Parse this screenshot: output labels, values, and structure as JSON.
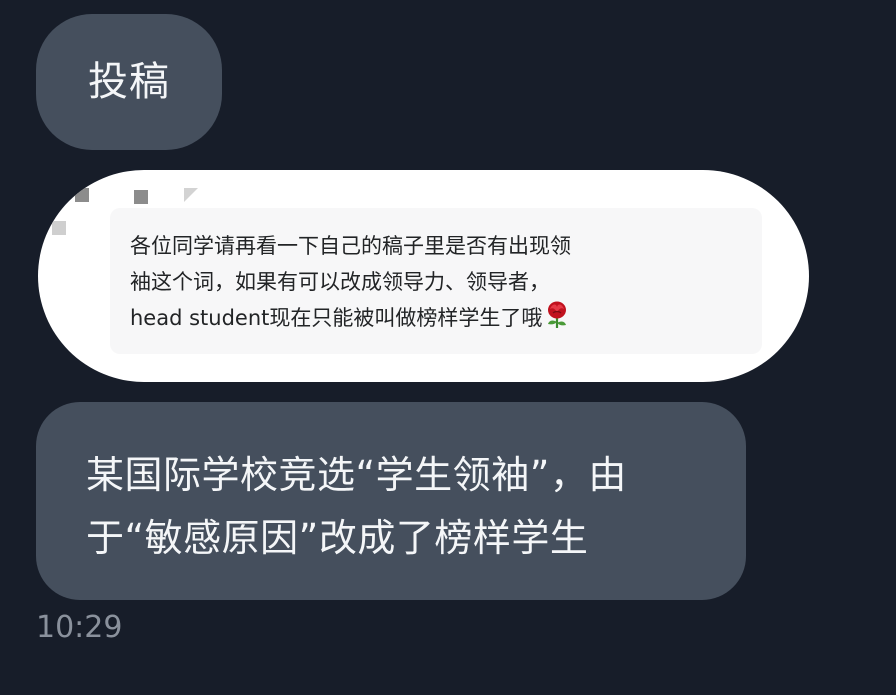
{
  "messages": {
    "title_bubble": {
      "text": "投稿"
    },
    "screenshot_note": {
      "line1": "各位同学请再看一下自己的稿子里是否有出现领",
      "line2": "袖这个词，如果有可以改成领导力、领导者，",
      "line3": "head student现在只能被叫做榜样学生了哦",
      "emoji": "rose-icon"
    },
    "main_bubble": {
      "line1": "某国际学校竞选“学生领袖”，由",
      "line2": "于“敏感原因”改成了榜样学生"
    }
  },
  "timestamp": "10:29",
  "colors": {
    "background": "#171d29",
    "bubble": "#454f5d",
    "bubble_text": "#f4f6f8",
    "timestamp": "#8a919c",
    "image_bubble": "#ffffff",
    "note_text": "#222426"
  }
}
